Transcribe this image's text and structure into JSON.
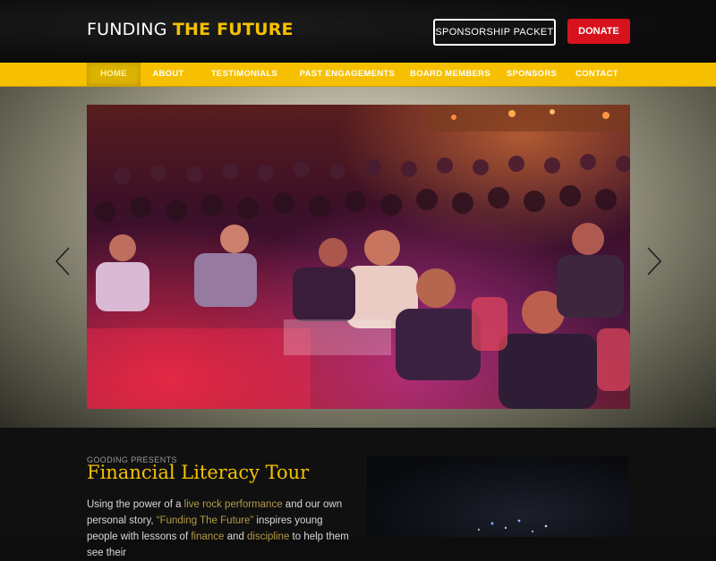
{
  "header": {
    "brand_prefix": "FUNDING",
    "brand_accent": "THE FUTURE",
    "sponsorship_label": "SPONSORSHIP PACKET",
    "donate_label": "DONATE"
  },
  "nav": {
    "items": [
      {
        "label": "HOME",
        "active": true
      },
      {
        "label": "ABOUT"
      },
      {
        "label": "TESTIMONIALS"
      },
      {
        "label": "PAST ENGAGEMENTS"
      },
      {
        "label": "BOARD MEMBERS"
      },
      {
        "label": "SPONSORS"
      },
      {
        "label": "CONTACT"
      }
    ]
  },
  "hero": {
    "icons": {
      "prev": "chevron-left-icon",
      "next": "chevron-right-icon"
    }
  },
  "content": {
    "eyebrow": "GOODING PRESENTS",
    "title": "Financial Literacy Tour",
    "paragraph": {
      "t1": "Using the power of a ",
      "link1": "live rock performance",
      "t2": " and our own personal story, ",
      "link2": "“Funding The Future”",
      "t3": " inspires young people with lessons of ",
      "link3": "finance",
      "t4": " and ",
      "link4": "discipline",
      "t5": " to help them see their"
    }
  },
  "colors": {
    "accent_yellow": "#f6c000",
    "donate_red": "#d7121d",
    "background_dark": "#0d0d0d"
  }
}
